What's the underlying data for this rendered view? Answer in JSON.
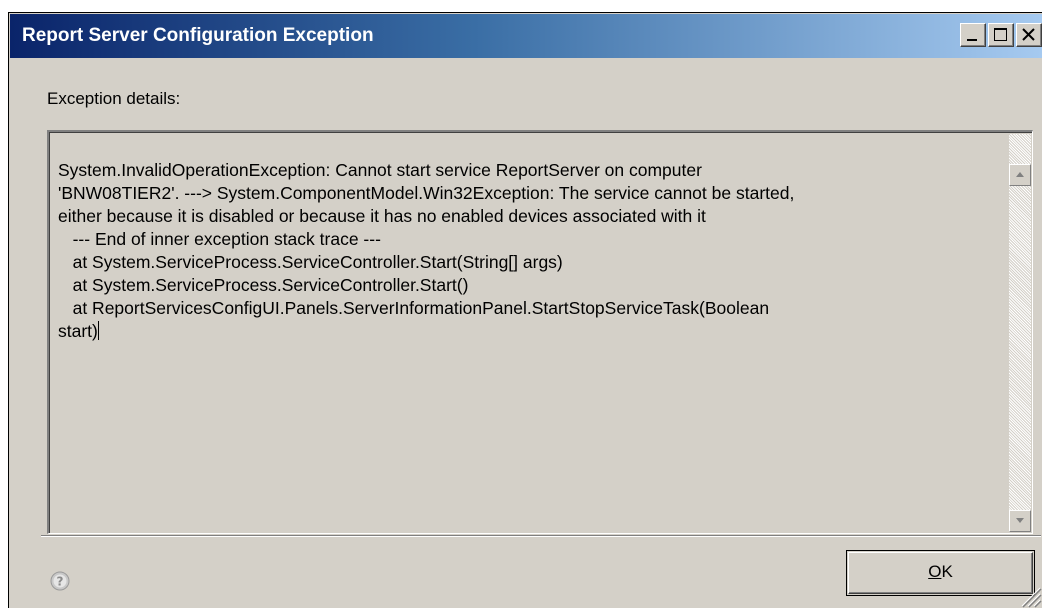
{
  "window": {
    "title": "Report Server Configuration Exception",
    "minimize_label": "Minimize",
    "maximize_label": "Maximize",
    "close_label": "Close"
  },
  "details": {
    "label": "Exception details:",
    "text": "System.InvalidOperationException: Cannot start service ReportServer on computer\n'BNW08TIER2'. ---> System.ComponentModel.Win32Exception: The service cannot be started,\neither because it is disabled or because it has no enabled devices associated with it\n   --- End of inner exception stack trace ---\n   at System.ServiceProcess.ServiceController.Start(String[] args)\n   at System.ServiceProcess.ServiceController.Start()\n   at ReportServicesConfigUI.Panels.ServerInformationPanel.StartStopServiceTask(Boolean\nstart)"
  },
  "footer": {
    "help_icon": "help-icon",
    "ok_access_key": "O",
    "ok_rest": "K"
  },
  "colors": {
    "dialog_face": "#d4d0c8",
    "titlebar_start": "#0a246a",
    "titlebar_end": "#a6caf0",
    "title_text": "#ffffff"
  }
}
